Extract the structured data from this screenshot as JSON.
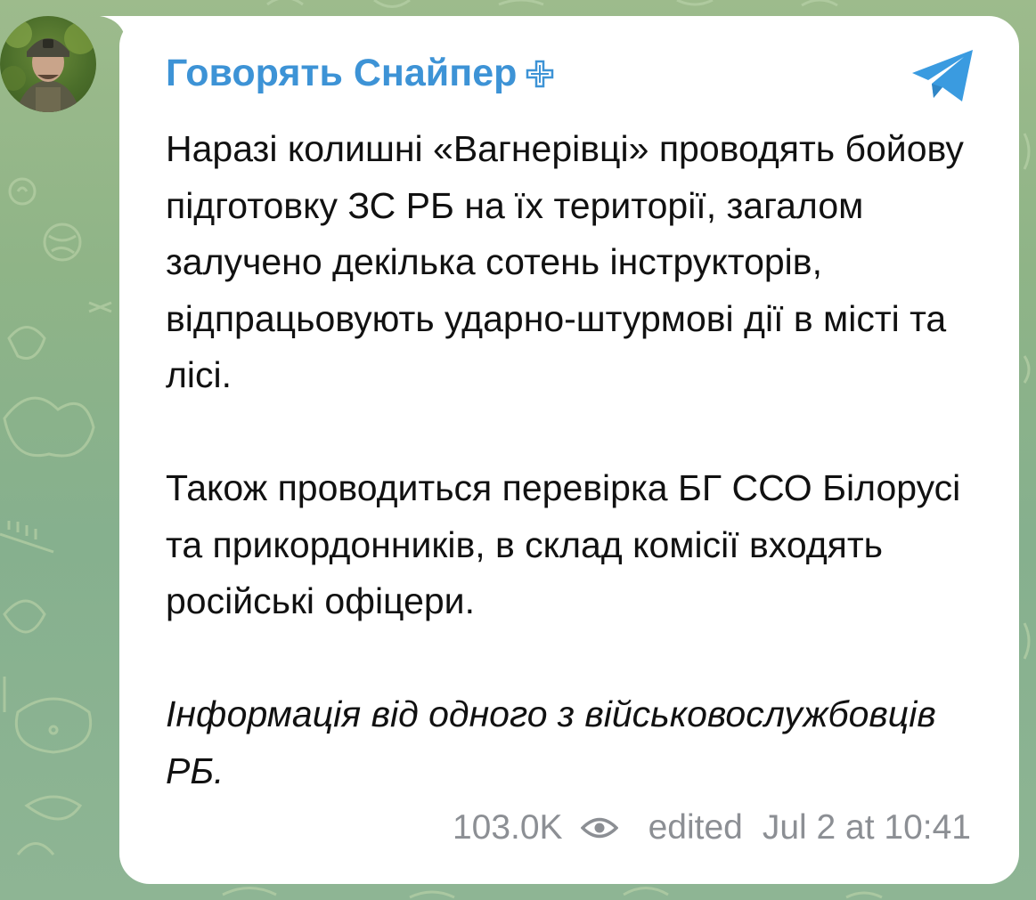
{
  "channel": {
    "name": "Говорять Снайпер",
    "badge_icon": "cross-icon",
    "logo_icon": "telegram-icon",
    "accent_color": "#3d93d6"
  },
  "message": {
    "paragraphs": [
      "Наразі колишні «Вагнерівці» проводять бойову підготовку ЗС РБ на їх території, загалом залучено декілька сотень інструкторів, відпрацьовують ударно-штурмові дії в місті та лісі.",
      "Також проводиться перевірка БГ ССО Білорусі та прикордонників, в склад комісії входять російські офіцери.",
      "Інформація від одного з військовослужбовців РБ."
    ]
  },
  "meta": {
    "views": "103.0K",
    "views_icon": "eye-icon",
    "edited_label": "edited",
    "timestamp": "Jul 2 at 10:41"
  }
}
